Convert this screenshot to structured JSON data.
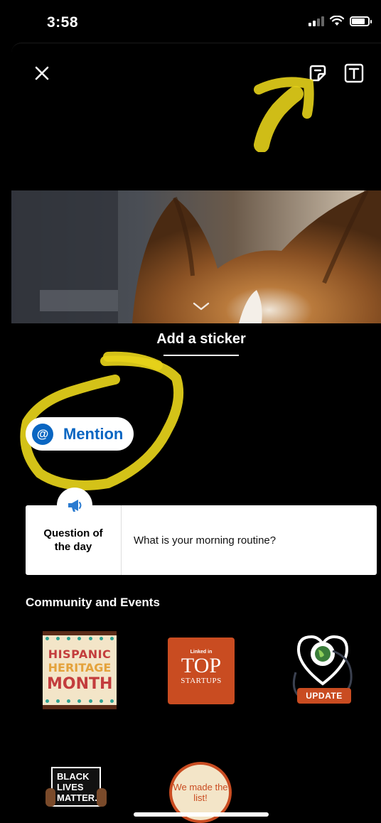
{
  "status": {
    "time": "3:58"
  },
  "sheet": {
    "title": "Add a sticker",
    "mention_label": "Mention",
    "mention_symbol": "@",
    "question_card": {
      "label": "Question of the day",
      "question": "What is your morning routine?"
    },
    "section_title": "Community and Events"
  },
  "stickers": {
    "hispanic": {
      "line1": "HISPANIC",
      "line2": "HERITAGE",
      "line3": "MONTH"
    },
    "top_startups": {
      "brand": "Linked in",
      "big": "TOP",
      "small": "STARTUPS"
    },
    "update": {
      "tag": "UPDATE"
    },
    "blm": {
      "text": "BLACK LIVES MATTER."
    },
    "made_list": {
      "text": "We made the list!"
    }
  },
  "colors": {
    "accent": "#0a66c2",
    "annotation": "#e6d21a",
    "sticker_orange": "#c94c21"
  },
  "icons": [
    "close-icon",
    "sticker-icon",
    "text-tool-icon",
    "chevron-down-icon",
    "megaphone-icon",
    "at-icon"
  ]
}
